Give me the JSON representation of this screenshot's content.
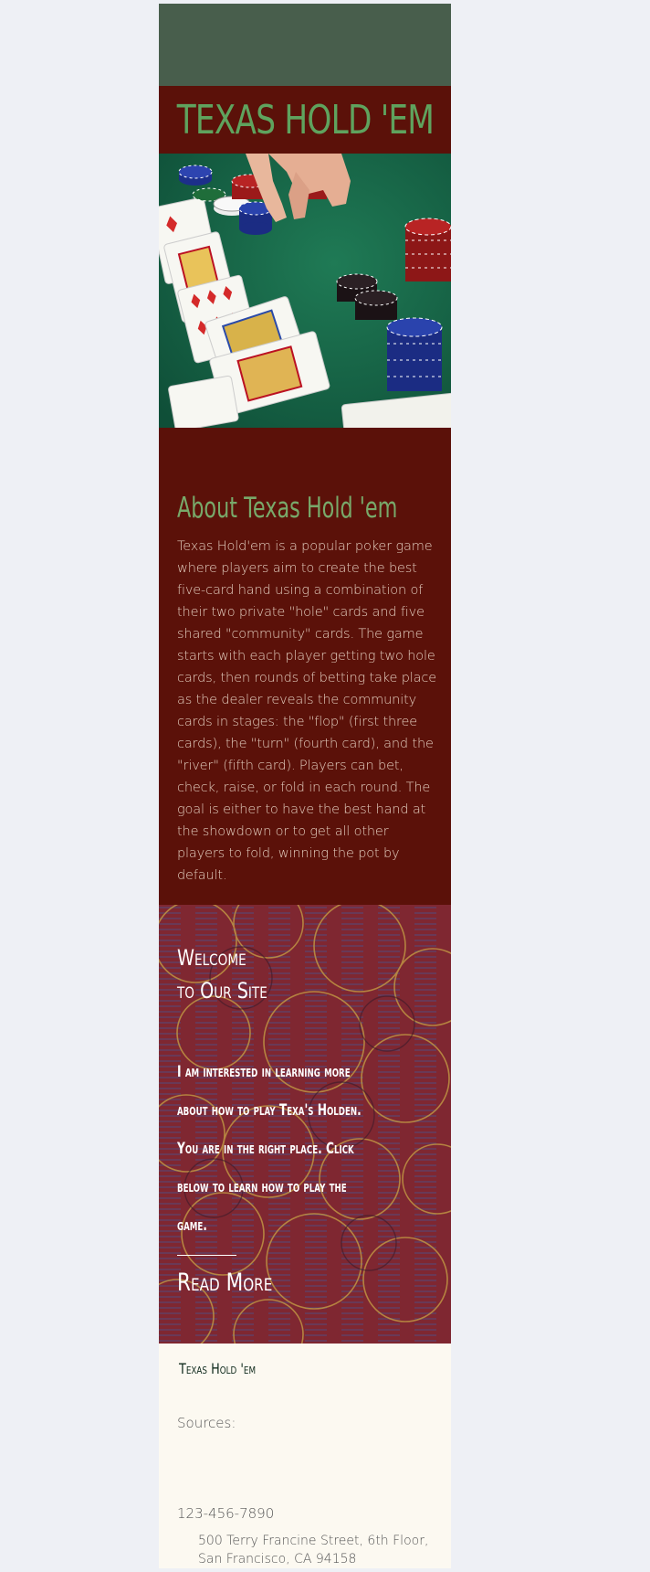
{
  "header": {
    "title": "TEXAS HOLD 'EM"
  },
  "hero": {
    "image_desc": "poker-table-cards-chips"
  },
  "about": {
    "heading": "About Texas Hold 'em",
    "body": "Texas Hold'em is a popular poker game where players aim to create the best five-card hand using a combination of their two private \"hole\" cards and five shared \"community\" cards. The game starts with each player getting two hole cards, then rounds of betting take place as the dealer reveals the community cards in stages: the \"flop\" (first three cards), the \"turn\" (fourth card), and the \"river\" (fifth card). Players can bet, check, raise, or fold in each round. The goal is either to have the best hand at the showdown or to get all other players to fold, winning the pot by default."
  },
  "welcome": {
    "heading_line1": "Welcome",
    "heading_line2": "to Our Site",
    "blurb_lines": [
      "I am interested in learning more",
      "about how to play Texa's Holden.",
      "You are in the right place. Click",
      "below to learn how to play the",
      "game."
    ],
    "read_more_label": "Read More"
  },
  "footer": {
    "title": "Texas Hold 'em",
    "sources_label": "Sources:",
    "phone": "123-456-7890",
    "address_line1": "500 Terry Francine Street, 6th Floor,",
    "address_line2": "San Francisco, CA 94158"
  },
  "colors": {
    "background": "#eef0f5",
    "top_band": "#485e4c",
    "maroon": "#5b1109",
    "title_green": "#5fa35e",
    "footer_bg": "#fcf9f1"
  }
}
